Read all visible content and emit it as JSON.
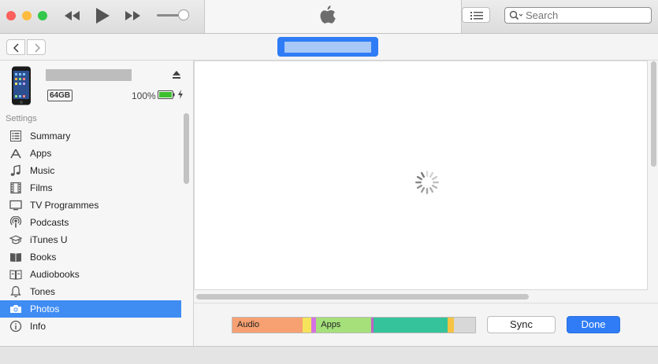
{
  "toolbar": {
    "search_placeholder": "Search",
    "volume_level": 0.85,
    "colors": {
      "close": "#fc605c",
      "minimize": "#fdbc40",
      "zoom": "#34c84a"
    }
  },
  "device": {
    "capacity": "64GB",
    "battery_percent": "100%",
    "battery_level": 1.0,
    "battery_color": "#3fbf30",
    "selected_color": "#2f7cf6"
  },
  "sidebar": {
    "section_title": "Settings",
    "items": [
      {
        "label": "Summary",
        "icon": "list-icon"
      },
      {
        "label": "Apps",
        "icon": "app-store-icon"
      },
      {
        "label": "Music",
        "icon": "music-note-icon"
      },
      {
        "label": "Films",
        "icon": "film-icon"
      },
      {
        "label": "TV Programmes",
        "icon": "tv-icon"
      },
      {
        "label": "Podcasts",
        "icon": "podcast-icon"
      },
      {
        "label": "iTunes U",
        "icon": "graduation-cap-icon"
      },
      {
        "label": "Books",
        "icon": "book-icon"
      },
      {
        "label": "Audiobooks",
        "icon": "audiobook-icon"
      },
      {
        "label": "Tones",
        "icon": "bell-icon"
      },
      {
        "label": "Photos",
        "icon": "camera-icon",
        "selected": true
      },
      {
        "label": "Info",
        "icon": "info-icon"
      }
    ]
  },
  "storage": {
    "segments": [
      {
        "label": "Audio",
        "color": "#f7a071",
        "share": 0.29
      },
      {
        "label": "",
        "color": "#f4e35b",
        "share": 0.035
      },
      {
        "label": "",
        "color": "#d671e3",
        "share": 0.02
      },
      {
        "label": "Apps",
        "color": "#a5e07b",
        "share": 0.225
      },
      {
        "label": "",
        "color": "#c060c8",
        "share": 0.012
      },
      {
        "label": "",
        "color": "#34c39b",
        "share": 0.305
      },
      {
        "label": "",
        "color": "#f6c343",
        "share": 0.025
      },
      {
        "label": "",
        "color": "#d8d8d8",
        "share": 0.088
      }
    ]
  },
  "actions": {
    "sync_label": "Sync",
    "done_label": "Done"
  }
}
